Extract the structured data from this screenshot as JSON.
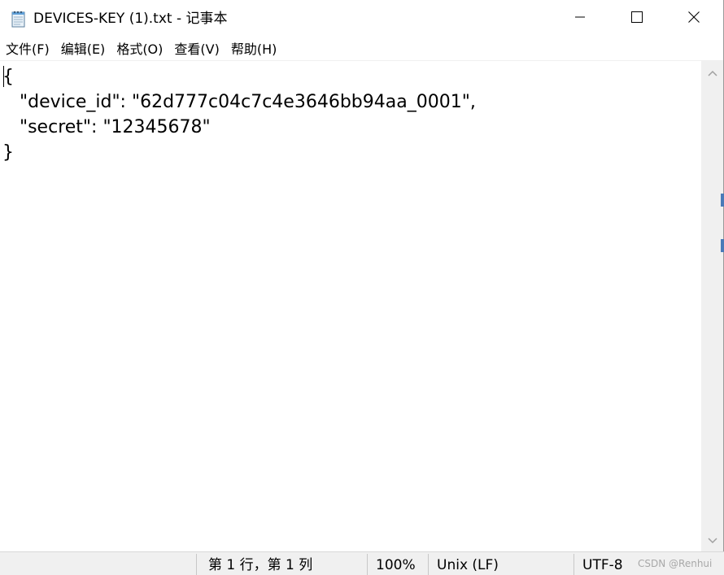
{
  "window": {
    "title": "DEVICES-KEY (1).txt - 记事本",
    "app_icon": "notepad-icon",
    "controls": {
      "minimize_icon": "minimize-icon",
      "maximize_icon": "maximize-icon",
      "close_icon": "close-icon"
    }
  },
  "menu": {
    "items": [
      {
        "label": "文件(F)"
      },
      {
        "label": "编辑(E)"
      },
      {
        "label": "格式(O)"
      },
      {
        "label": "查看(V)"
      },
      {
        "label": "帮助(H)"
      }
    ]
  },
  "editor": {
    "content": "{\n   \"device_id\": \"62d777c04c7c4e3646bb94aa_0001\",\n   \"secret\": \"12345678\"\n}"
  },
  "status": {
    "position": "第 1 行，第 1 列",
    "zoom": "100%",
    "line_ending": "Unix (LF)",
    "encoding": "UTF-8"
  },
  "watermark": "CSDN @Renhui",
  "colors": {
    "status_bg": "#f0f0f0",
    "scrollbar_bg": "#f0f0f0",
    "text": "#000000"
  }
}
